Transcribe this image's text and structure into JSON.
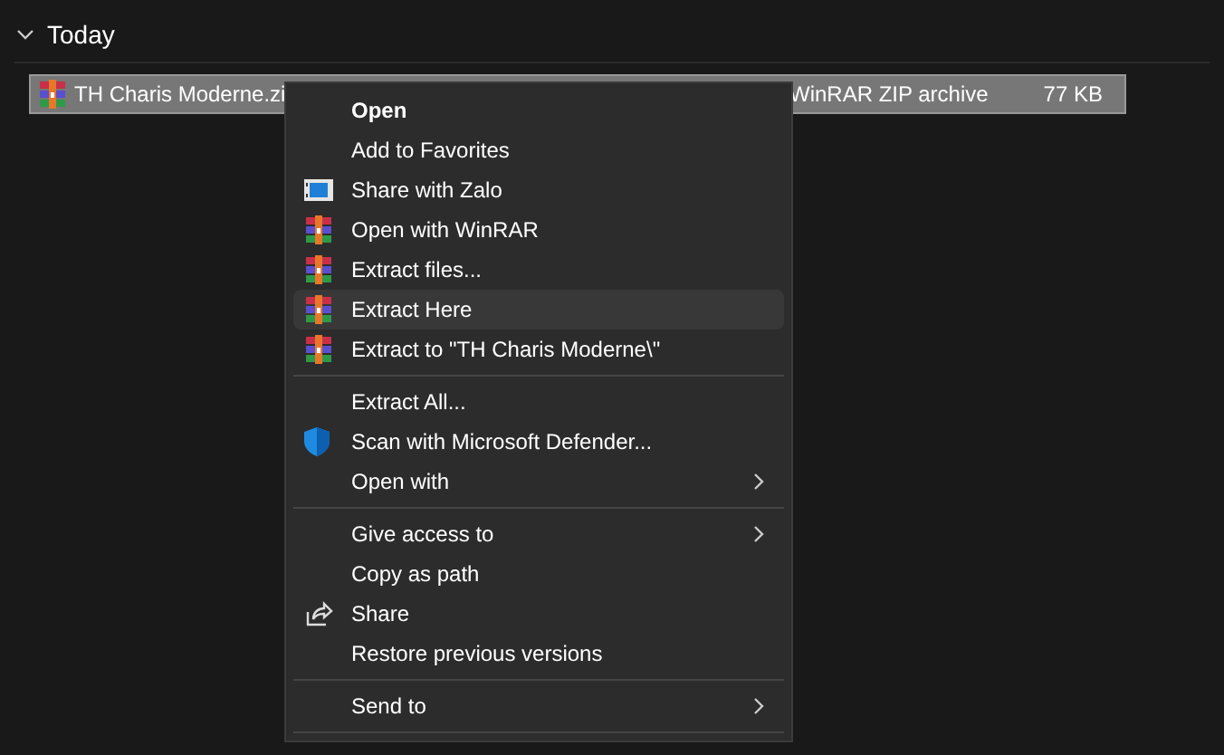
{
  "group": {
    "title": "Today",
    "expanded": true
  },
  "files": [
    {
      "name": "TH Charis Moderne.zi",
      "type": "WinRAR ZIP archive",
      "size": "77 KB",
      "selected": true
    }
  ],
  "context_menu": {
    "sections": [
      {
        "items": [
          {
            "label": "Open",
            "default": true,
            "kind": "plain",
            "submenu": false,
            "selected": false
          },
          {
            "label": "Add to Favorites",
            "default": false,
            "kind": "plain",
            "submenu": false,
            "selected": false
          },
          {
            "label": "Share with Zalo",
            "default": false,
            "kind": "film",
            "submenu": false,
            "selected": false
          },
          {
            "label": "Open with WinRAR",
            "default": false,
            "kind": "archive",
            "submenu": false,
            "selected": false
          },
          {
            "label": "Extract files...",
            "default": false,
            "kind": "archive",
            "submenu": false,
            "selected": false
          },
          {
            "label": "Extract Here",
            "default": false,
            "kind": "archive",
            "submenu": false,
            "selected": true
          },
          {
            "label": "Extract to \"TH Charis Moderne\\\"",
            "default": false,
            "kind": "archive",
            "submenu": false,
            "selected": false
          }
        ]
      },
      {
        "items": [
          {
            "label": "Extract All...",
            "default": false,
            "kind": "plain",
            "submenu": false,
            "selected": false
          },
          {
            "label": "Scan with Microsoft Defender...",
            "default": false,
            "kind": "shield",
            "submenu": false,
            "selected": false
          },
          {
            "label": "Open with",
            "default": false,
            "kind": "plain",
            "submenu": true,
            "selected": false
          }
        ]
      },
      {
        "items": [
          {
            "label": "Give access to",
            "default": false,
            "kind": "plain",
            "submenu": true,
            "selected": false
          },
          {
            "label": "Copy as path",
            "default": false,
            "kind": "plain",
            "submenu": false,
            "selected": false
          },
          {
            "label": "Share",
            "default": false,
            "kind": "share",
            "submenu": false,
            "selected": false
          },
          {
            "label": "Restore previous versions",
            "default": false,
            "kind": "plain",
            "submenu": false,
            "selected": false
          }
        ]
      },
      {
        "items": [
          {
            "label": "Send to",
            "default": false,
            "kind": "plain",
            "submenu": true,
            "selected": false
          }
        ]
      }
    ]
  }
}
